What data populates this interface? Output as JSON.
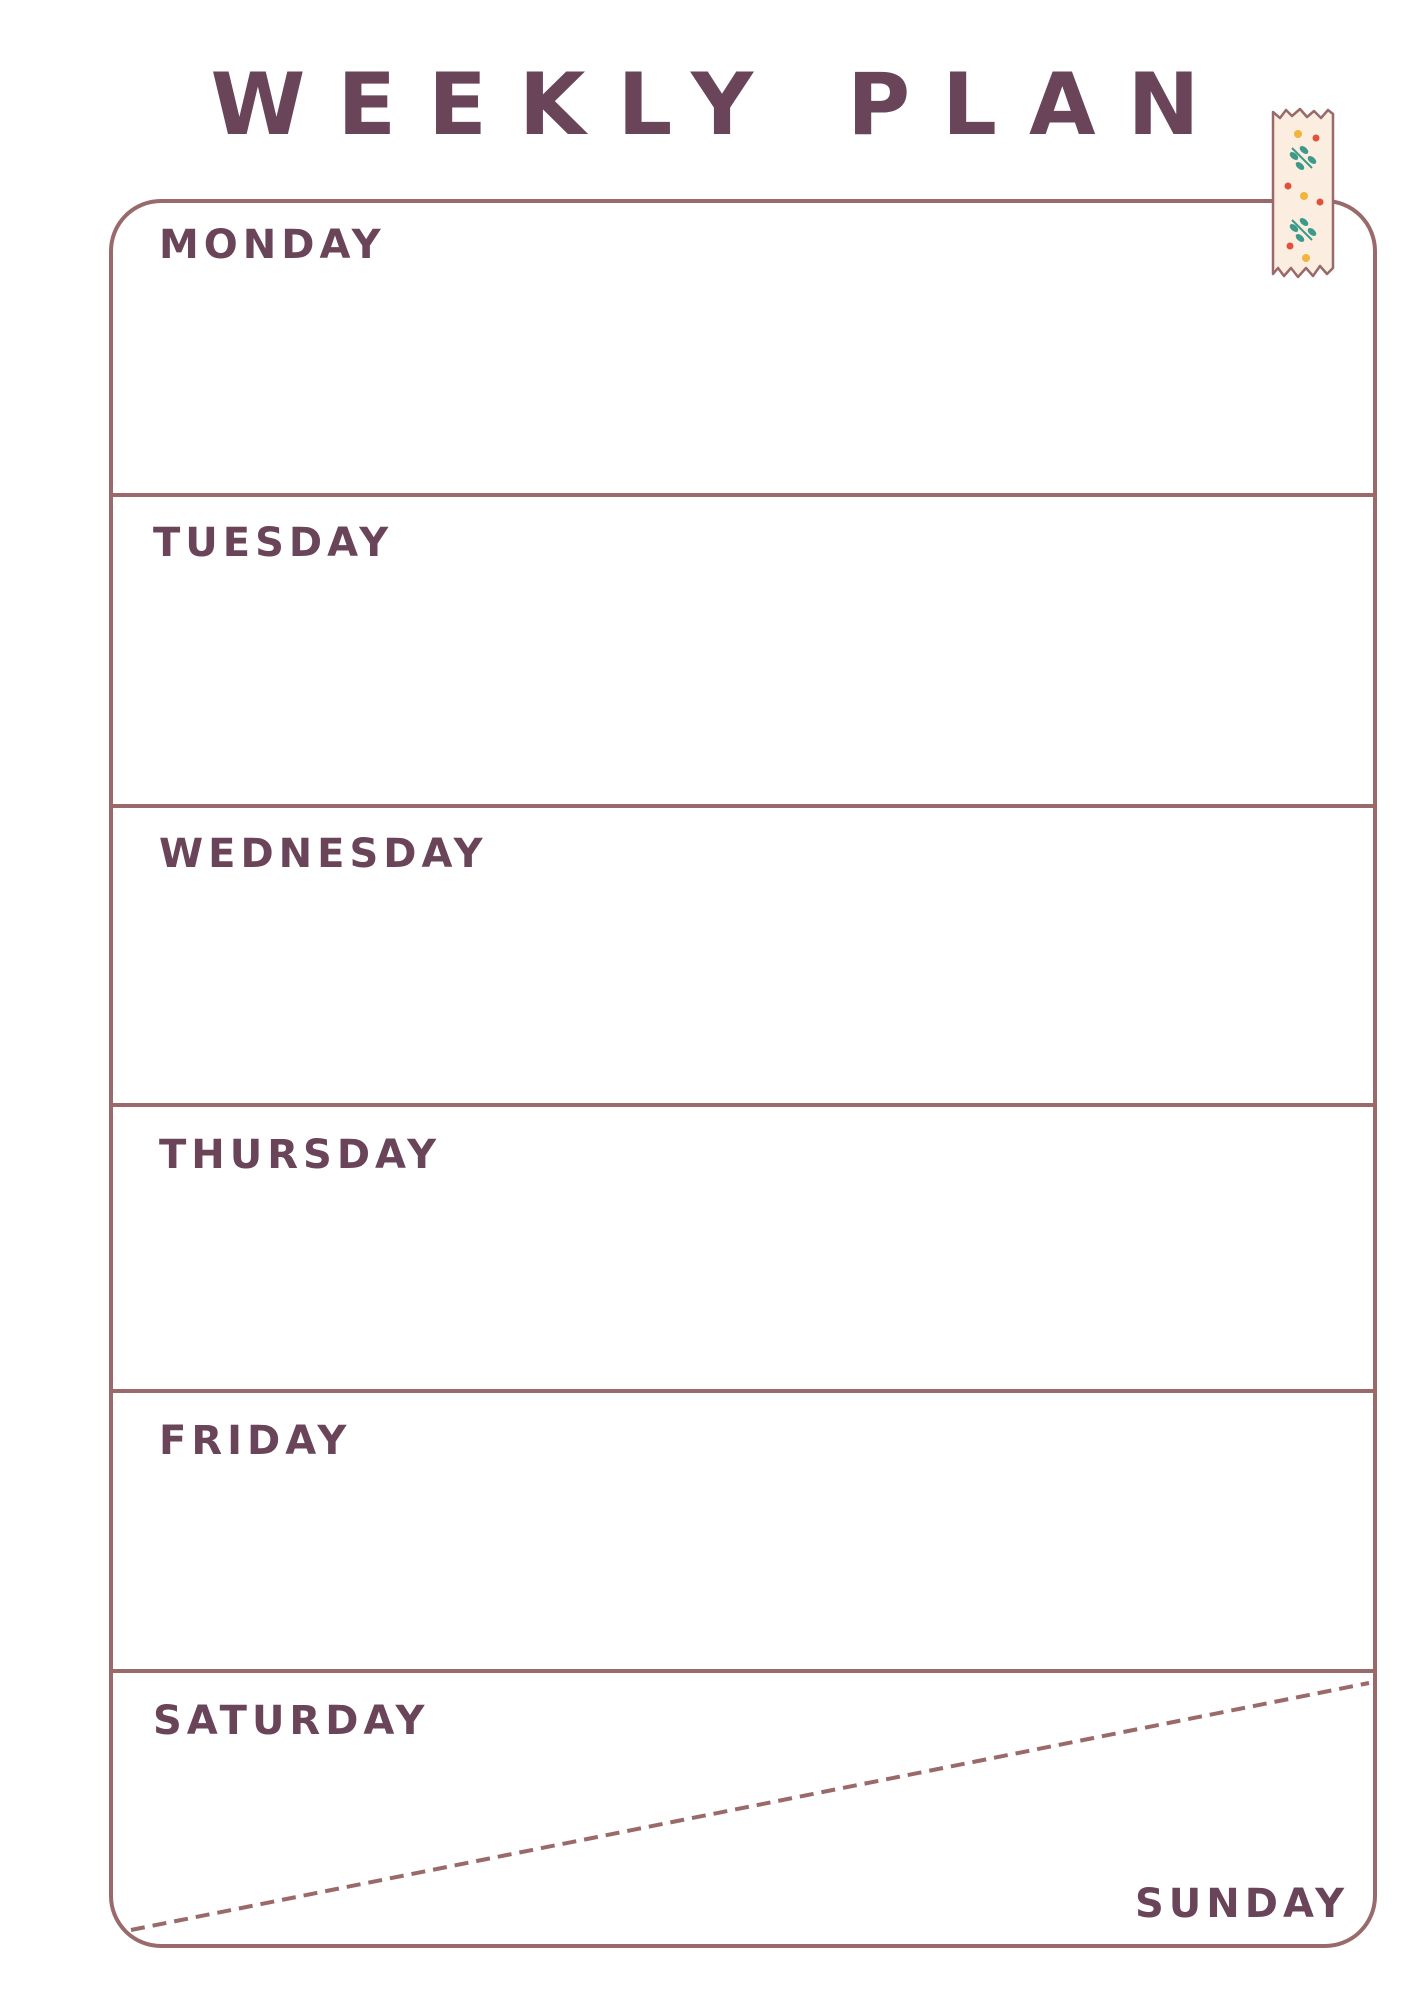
{
  "title": "WEEKLY PLAN",
  "days": {
    "monday": "MONDAY",
    "tuesday": "TUESDAY",
    "wednesday": "WEDNESDAY",
    "thursday": "THURSDAY",
    "friday": "FRIDAY",
    "saturday": "SATURDAY",
    "sunday": "SUNDAY"
  },
  "colors": {
    "text": "#6a4459",
    "border": "#9a6a6a",
    "tape": "#fbeee0",
    "leaf": "#3d9a8a",
    "flower_red": "#e0523c",
    "flower_yellow": "#f2b53a"
  },
  "icons": {
    "tape": "washi-tape-icon"
  }
}
